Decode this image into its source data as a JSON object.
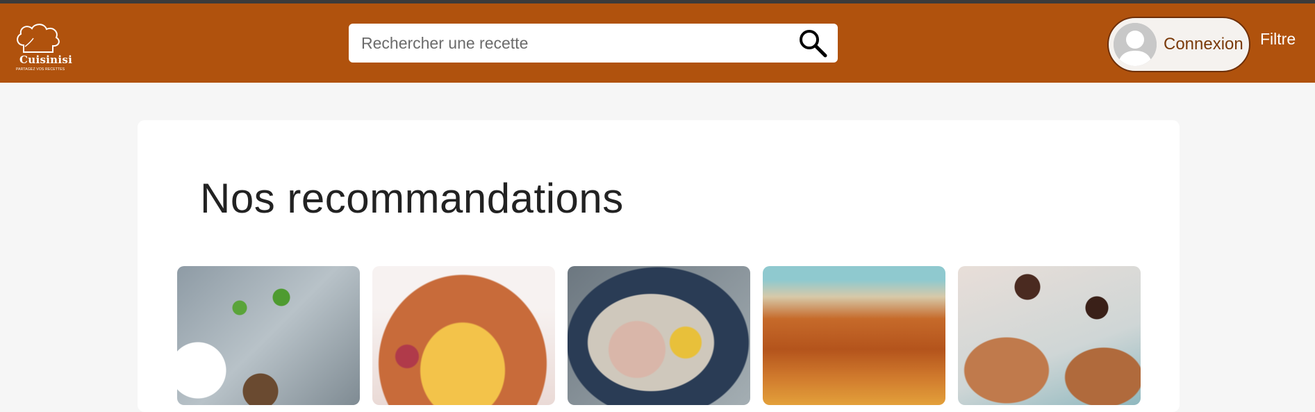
{
  "header": {
    "logo": {
      "name": "Cuisinisi",
      "tagline": "PARTAGEZ VOS RECETTES"
    },
    "search": {
      "placeholder": "Rechercher une recette",
      "value": ""
    },
    "login_label": "Connexion",
    "filter_label": "Filtre",
    "colors": {
      "header_bg": "#b0520d",
      "login_text": "#7a3a0a"
    }
  },
  "main": {
    "section_title": "Nos recommandations",
    "recipes": [
      {
        "image": "recipe-image-1"
      },
      {
        "image": "recipe-image-2"
      },
      {
        "image": "recipe-image-3"
      },
      {
        "image": "recipe-image-4"
      },
      {
        "image": "recipe-image-5"
      }
    ]
  }
}
